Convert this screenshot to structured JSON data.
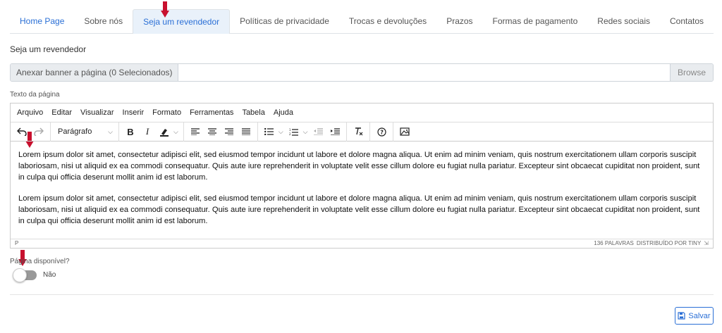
{
  "tabs": [
    {
      "label": "Home Page"
    },
    {
      "label": "Sobre nós"
    },
    {
      "label": "Seja um revendedor"
    },
    {
      "label": "Políticas de privacidade"
    },
    {
      "label": "Trocas e devoluções"
    },
    {
      "label": "Prazos"
    },
    {
      "label": "Formas de pagamento"
    },
    {
      "label": "Redes sociais"
    },
    {
      "label": "Contatos"
    }
  ],
  "active_tab": "Seja um revendedor",
  "section_title": "Seja um revendedor",
  "banner": {
    "label": "Anexar banner a página (0 Selecionados)",
    "browse": "Browse"
  },
  "editor": {
    "label": "Texto da página",
    "menu": [
      "Arquivo",
      "Editar",
      "Visualizar",
      "Inserir",
      "Formato",
      "Ferramentas",
      "Tabela",
      "Ajuda"
    ],
    "block_format": "Parágrafo",
    "paragraphs": [
      "Lorem ipsum dolor sit amet, consectetur adipisci elit, sed eiusmod tempor incidunt ut labore et dolore magna aliqua. Ut enim ad minim veniam, quis nostrum exercitationem ullam corporis suscipit laboriosam, nisi ut aliquid ex ea commodi consequatur. Quis aute iure reprehenderit in voluptate velit esse cillum dolore eu fugiat nulla pariatur. Excepteur sint obcaecat cupiditat non proident, sunt in culpa qui officia deserunt mollit anim id est laborum.",
      "Lorem ipsum dolor sit amet, consectetur adipisci elit, sed eiusmod tempor incidunt ut labore et dolore magna aliqua. Ut enim ad minim veniam, quis nostrum exercitationem ullam corporis suscipit laboriosam, nisi ut aliquid ex ea commodi consequatur. Quis aute iure reprehenderit in voluptate velit esse cillum dolore eu fugiat nulla pariatur. Excepteur sint obcaecat cupiditat non proident, sunt in culpa qui officia deserunt mollit anim id est laborum."
    ],
    "status_path": "P",
    "word_count": "136 PALAVRAS",
    "powered_by": "DISTRIBUÍDO POR TINY"
  },
  "availability": {
    "label": "Página disponível?",
    "state": "Não"
  },
  "save_label": "Salvar",
  "colors": {
    "accent": "#2a6fd6",
    "annotation_arrow": "#c8102e"
  }
}
